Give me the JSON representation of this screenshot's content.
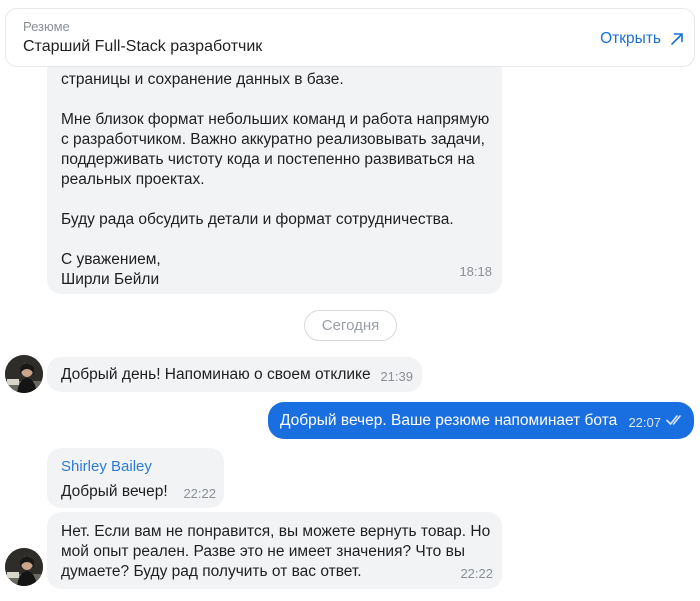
{
  "resume": {
    "label": "Резюме",
    "title": "Старший Full-Stack разработчик",
    "open_label": "Открыть"
  },
  "messages": {
    "m1": {
      "partial_line": "страницы и сохранение данных в базе.",
      "paragraph_2": "Мне близок формат небольших команд и работа напрямую с разработчиком. Важно аккуратно реализовывать задачи, поддерживать чистоту кода и постепенно развиваться на реальных проектах.",
      "paragraph_3": "Буду рада обсудить детали и формат сотрудничества.",
      "sign_1": "С уважением,",
      "sign_2": "Ширли Бейли",
      "time": "18:18"
    },
    "date_separator": "Сегодня",
    "m2": {
      "text": "Добрый день! Напоминаю о своем отклике",
      "time": "21:39"
    },
    "m3": {
      "text": "Добрый вечер. Ваше резюме напоминает бота",
      "time": "22:07"
    },
    "m4": {
      "sender": "Shirley Bailey",
      "text": "Добрый вечер!",
      "time": "22:22"
    },
    "m5": {
      "text": "Нет. Если вам не понравится, вы можете вернуть товар. Но мой опыт реален. Разве это не имеет значения? Что вы думаете? Буду рад получить от вас ответ.",
      "time": "22:22"
    }
  },
  "icons": {
    "open": "arrow-up-right-icon",
    "read": "double-check-icon",
    "avatar": "user-photo"
  },
  "colors": {
    "accent": "#1a6fd6",
    "outgoing_bubble": "#1a6fe0",
    "incoming_bubble": "#f2f3f5",
    "sender_name": "#2c7bd6",
    "muted": "#8a8f96"
  }
}
